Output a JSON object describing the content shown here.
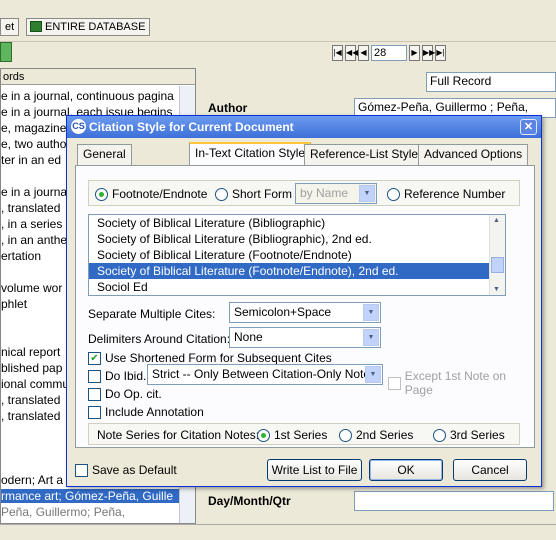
{
  "toolbar": {
    "btn_partial": "et",
    "database_label": "ENTIRE DATABASE"
  },
  "nav": {
    "first": "|◀",
    "prev_page": "◀◀",
    "prev": "◀",
    "record_number": "28",
    "next": "▶",
    "next_page": "▶▶",
    "last": "▶|"
  },
  "left_pane": {
    "header": "ords",
    "rows": [
      "e in a journal, continuous pagina",
      "e in a journal, each issue begins",
      "e, magazine",
      "e, two author",
      "ter in an ed",
      "e in a journa",
      ", translated",
      ", in a series",
      ", in an anthe",
      "ertation",
      "volume wor",
      "phlet",
      "nical report",
      "blished pap",
      "ional commu",
      ", translated",
      ", translated",
      "odern; Art a",
      "rmance art; Gómez-Peña, Guille",
      "  Peña, Guillermo; Peña,"
    ]
  },
  "right_pane": {
    "view_mode": "Full Record",
    "author_label": "Author",
    "author_value": "Gómez-Peña, Guillermo ; Peña,",
    "daymonth_label": "Day/Month/Qtr"
  },
  "dialog": {
    "title": "Citation Style for Current Document",
    "tabs": [
      "General",
      "In-Text Citation Style",
      "Reference-List Style",
      "Advanced Options"
    ],
    "radio_footnote": "Footnote/Endnote",
    "radio_short_form": "Short Form",
    "short_form_combo": "by Name",
    "radio_reference_number": "Reference Number",
    "styles": [
      "Society of Biblical Literature (Bibliographic)",
      "Society of Biblical Literature (Bibliographic), 2nd ed.",
      "Society of Biblical Literature (Footnote/Endnote)",
      "Society of Biblical Literature (Footnote/Endnote), 2nd ed.",
      "Sociol Ed"
    ],
    "selected_style_index": 3,
    "separate_label": "Separate Multiple Cites:",
    "separate_value": "Semicolon+Space",
    "delimiters_label": "Delimiters Around Citation:",
    "delimiters_value": "None",
    "shortened_label": "Use Shortened Form for Subsequent Cites",
    "ibid_label": "Do Ibid.",
    "ibid_value": "Strict -- Only Between Citation-Only Notes",
    "except_label": "Except 1st Note on Page",
    "opcit_label": "Do Op. cit.",
    "annotation_label": "Include Annotation",
    "note_series_label": "Note Series for Citation Notes:",
    "series": [
      "1st Series",
      "2nd Series",
      "3rd Series"
    ],
    "save_default": "Save as Default",
    "write_list": "Write List to File",
    "ok": "OK",
    "cancel": "Cancel"
  }
}
